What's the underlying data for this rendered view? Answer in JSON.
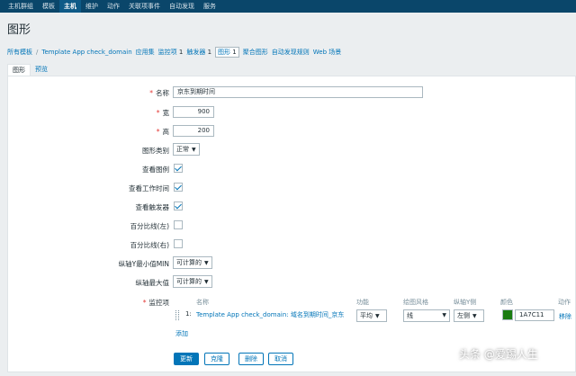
{
  "nav": {
    "items": [
      "主机群组",
      "模板",
      "主机",
      "维护",
      "动作",
      "关联项事件",
      "自动发现",
      "服务"
    ],
    "active_index": 2
  },
  "page_title": "图形",
  "breadcrumb": {
    "all_templates": "所有模板",
    "separator": "/",
    "template": "Template App check_domain",
    "applications": "应用集",
    "items_label": "监控项",
    "items_count": "1",
    "triggers_label": "触发器",
    "triggers_count": "1",
    "graphs_label": "图形",
    "graphs_count": "1",
    "screens": "聚合图形",
    "discovery": "自动发现规则",
    "web": "Web 场景"
  },
  "tabs": [
    "图形",
    "预览"
  ],
  "form": {
    "name_label": "名称",
    "name_value": "京东到期时间",
    "width_label": "宽",
    "width_value": "900",
    "height_label": "高",
    "height_value": "200",
    "graph_type_label": "图形类别",
    "graph_type_value": "正常",
    "show_legend_label": "查看图例",
    "show_working_time_label": "查看工作时间",
    "show_triggers_label": "查看触发器",
    "percentile_left_label": "百分比线(左)",
    "percentile_right_label": "百分比线(右)",
    "ymin_label": "纵轴Y最小值MIN",
    "ymin_value": "可计算的",
    "ymax_label": "纵轴最大值",
    "ymax_value": "可计算的",
    "items_label": "监控项"
  },
  "items_table": {
    "headers": {
      "name": "名称",
      "function": "功能",
      "draw_style": "绘图风格",
      "y_axis_side": "纵轴Y侧",
      "color": "颜色",
      "action": "动作"
    },
    "rows": [
      {
        "index": "1:",
        "name": "Template App check_domain: 域名到期时间_京东",
        "function": "平均",
        "draw_style": "线",
        "y_axis_side": "左侧",
        "color": "1A7C11",
        "action": "移除"
      }
    ],
    "add_link": "添加"
  },
  "buttons": {
    "update": "更新",
    "clone": "克隆",
    "delete": "删除",
    "cancel": "取消"
  },
  "watermark": "头条 @爱踢人生",
  "colors": {
    "nav_bg": "#0a466a",
    "link": "#0275b8",
    "item_color": "#1A7C11"
  }
}
